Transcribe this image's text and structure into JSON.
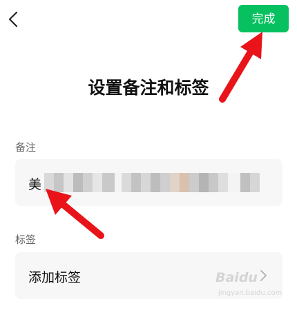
{
  "header": {
    "back_icon": "chevron-left-icon",
    "done_label": "完成",
    "accent_color": "#07c160"
  },
  "page": {
    "title": "设置备注和标签"
  },
  "remark": {
    "label": "备注",
    "value_visible": "美"
  },
  "tags": {
    "label": "标签",
    "add_label": "添加标签",
    "chevron_icon": "chevron-right-icon"
  },
  "watermark": {
    "brand": "Baidu",
    "sub": "jingyan.baidu.com"
  }
}
